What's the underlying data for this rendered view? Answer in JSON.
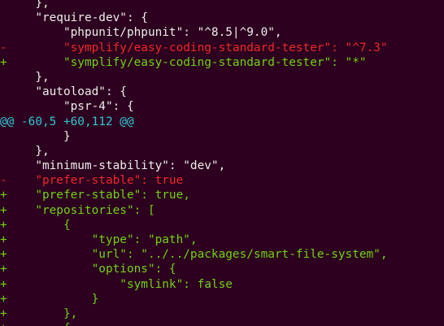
{
  "terminal": {
    "lines": [
      {
        "kind": "ctx",
        "text": "     },"
      },
      {
        "kind": "ctx",
        "text": "     \"require-dev\": {"
      },
      {
        "kind": "ctx",
        "text": "         \"phpunit/phpunit\": \"^8.5|^9.0\","
      },
      {
        "kind": "del",
        "text": "-        \"symplify/easy-coding-standard-tester\": \"^7.3\""
      },
      {
        "kind": "add",
        "text": "+        \"symplify/easy-coding-standard-tester\": \"*\""
      },
      {
        "kind": "ctx",
        "text": "     },"
      },
      {
        "kind": "ctx",
        "text": "     \"autoload\": {"
      },
      {
        "kind": "ctx",
        "text": "         \"psr-4\": {"
      },
      {
        "kind": "hunk",
        "text": "@@ -60,5 +60,112 @@"
      },
      {
        "kind": "ctx",
        "text": "         }"
      },
      {
        "kind": "ctx",
        "text": "     },"
      },
      {
        "kind": "ctx",
        "text": "     \"minimum-stability\": \"dev\","
      },
      {
        "kind": "del",
        "text": "-    \"prefer-stable\": true"
      },
      {
        "kind": "add",
        "text": "+    \"prefer-stable\": true,"
      },
      {
        "kind": "add",
        "text": "+    \"repositories\": ["
      },
      {
        "kind": "add",
        "text": "+        {"
      },
      {
        "kind": "add",
        "text": "+            \"type\": \"path\","
      },
      {
        "kind": "add",
        "text": "+            \"url\": \"../../packages/smart-file-system\","
      },
      {
        "kind": "add",
        "text": "+            \"options\": {"
      },
      {
        "kind": "add",
        "text": "+                \"symlink\": false"
      },
      {
        "kind": "add",
        "text": "+            }"
      },
      {
        "kind": "add",
        "text": "+        },"
      },
      {
        "kind": "add",
        "text": "+        {"
      }
    ]
  },
  "colors": {
    "background": "#2c001e",
    "context": "#eeeeec",
    "removed": "#ef2929",
    "added": "#73d216",
    "hunk": "#34c5d4"
  }
}
